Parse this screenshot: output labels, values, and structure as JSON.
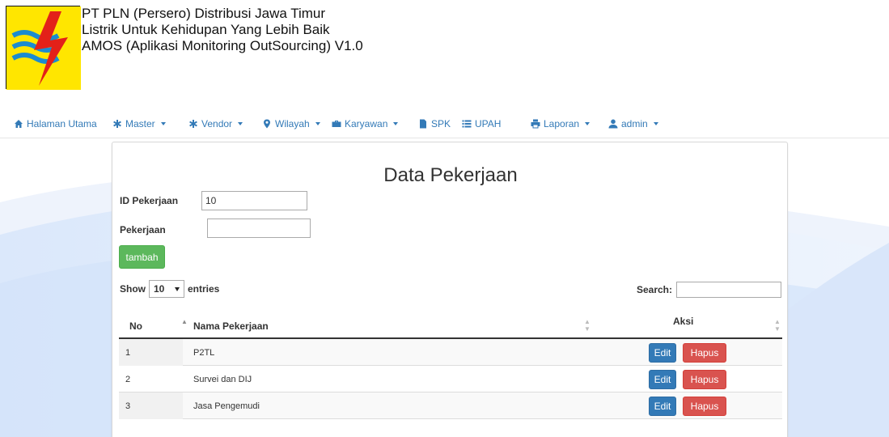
{
  "header": {
    "line1": "PT PLN (Persero) Distribusi Jawa Timur",
    "line2": "Listrik Untuk Kehidupan Yang Lebih Baik",
    "line3": "AMOS (Aplikasi Monitoring OutSourcing) V1.0",
    "logo_icon": "pln-logo-icon"
  },
  "colors": {
    "link": "#337ab7",
    "success": "#5cb85c",
    "danger": "#d9534f",
    "logo_yellow": "#ffe600",
    "logo_red": "#e32119",
    "logo_blue": "#1b8bd0"
  },
  "nav": [
    {
      "label": "Halaman Utama",
      "icon": "home-icon",
      "dropdown": false
    },
    {
      "label": "Master",
      "icon": "asterisk-icon",
      "dropdown": true
    },
    {
      "label": "Vendor",
      "icon": "asterisk-icon",
      "dropdown": true
    },
    {
      "label": "Wilayah",
      "icon": "map-marker-icon",
      "dropdown": true
    },
    {
      "label": "Karyawan",
      "icon": "briefcase-icon",
      "dropdown": true
    },
    {
      "label": "SPK",
      "icon": "file-icon",
      "dropdown": false
    },
    {
      "label": "UPAH",
      "icon": "list-icon",
      "dropdown": false
    },
    {
      "label": "Laporan",
      "icon": "print-icon",
      "dropdown": true
    },
    {
      "label": "admin",
      "icon": "user-icon",
      "dropdown": true
    }
  ],
  "form": {
    "title": "Data Pekerjaan",
    "id_label": "ID Pekerjaan",
    "id_value": "10",
    "name_label": "Pekerjaan",
    "name_value": "",
    "submit_label": "tambah"
  },
  "table_controls": {
    "show_label": "Show",
    "entries_value": "10",
    "entries_label": "entries",
    "search_label": "Search:",
    "search_value": ""
  },
  "table": {
    "columns": [
      "No",
      "Nama Pekerjaan",
      "Aksi"
    ],
    "rows": [
      {
        "no": "1",
        "name": "P2TL"
      },
      {
        "no": "2",
        "name": "Survei dan DIJ"
      },
      {
        "no": "3",
        "name": "Jasa Pengemudi"
      }
    ],
    "edit_label": "Edit",
    "delete_label": "Hapus"
  }
}
